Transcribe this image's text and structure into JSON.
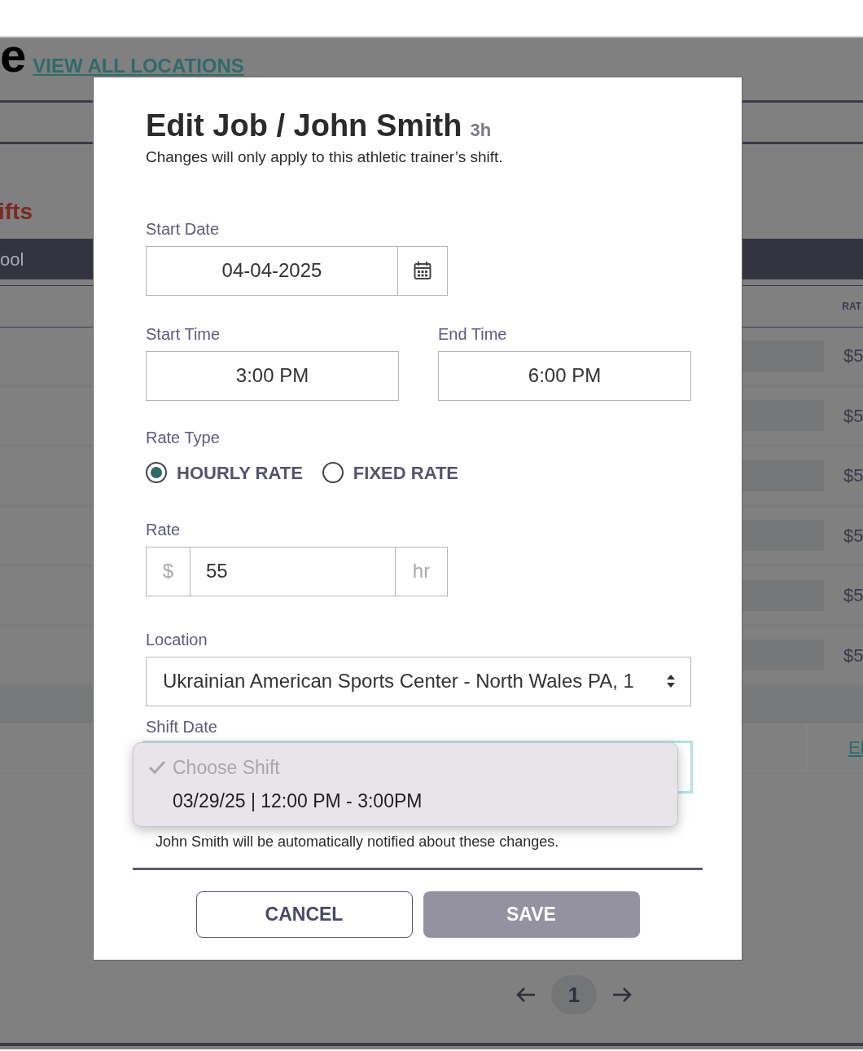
{
  "background": {
    "heading_fragment": "e",
    "locations_link": "VIEW ALL LOCATIONS",
    "section_fragment": "ifts",
    "bar_fragment": "ool",
    "column_fragment": "RAT",
    "rows": [
      {
        "rate": "$5"
      },
      {
        "rate": "$5"
      },
      {
        "rate": "$5"
      },
      {
        "rate": "$5"
      },
      {
        "rate": "$5"
      },
      {
        "rate": "$5"
      }
    ],
    "link_fragment": "El"
  },
  "pagination": {
    "pages": [
      {
        "label": "1",
        "selected": true
      }
    ]
  },
  "modal": {
    "title": "Edit Job / John Smith",
    "duration": "3h",
    "subtitle": "Changes will only apply to this athletic trainer’s shift.",
    "start_date": {
      "label": "Start Date",
      "value": "04-04-2025"
    },
    "start_time": {
      "label": "Start Time",
      "value": "3:00 PM"
    },
    "end_time": {
      "label": "End Time",
      "value": "6:00 PM"
    },
    "rate_type": {
      "label": "Rate Type",
      "options": [
        {
          "label": "HOURLY RATE",
          "selected": true
        },
        {
          "label": "FIXED RATE",
          "selected": false
        }
      ]
    },
    "rate": {
      "label": "Rate",
      "prefix": "$",
      "value": "55",
      "suffix": "hr"
    },
    "location": {
      "label": "Location",
      "value": "Ukrainian American Sports Center - North Wales PA, 1"
    },
    "shift_date": {
      "label": "Shift Date",
      "options": [
        {
          "label": "Choose Shift",
          "selected": true,
          "disabled": true
        },
        {
          "label": "03/29/25 | 12:00 PM - 3:00PM",
          "selected": false,
          "disabled": false
        }
      ]
    },
    "notice": "John Smith will be automatically notified about these changes.",
    "buttons": [
      {
        "label": "CANCEL",
        "kind": "outline"
      },
      {
        "label": "SAVE",
        "kind": "filled"
      }
    ]
  }
}
